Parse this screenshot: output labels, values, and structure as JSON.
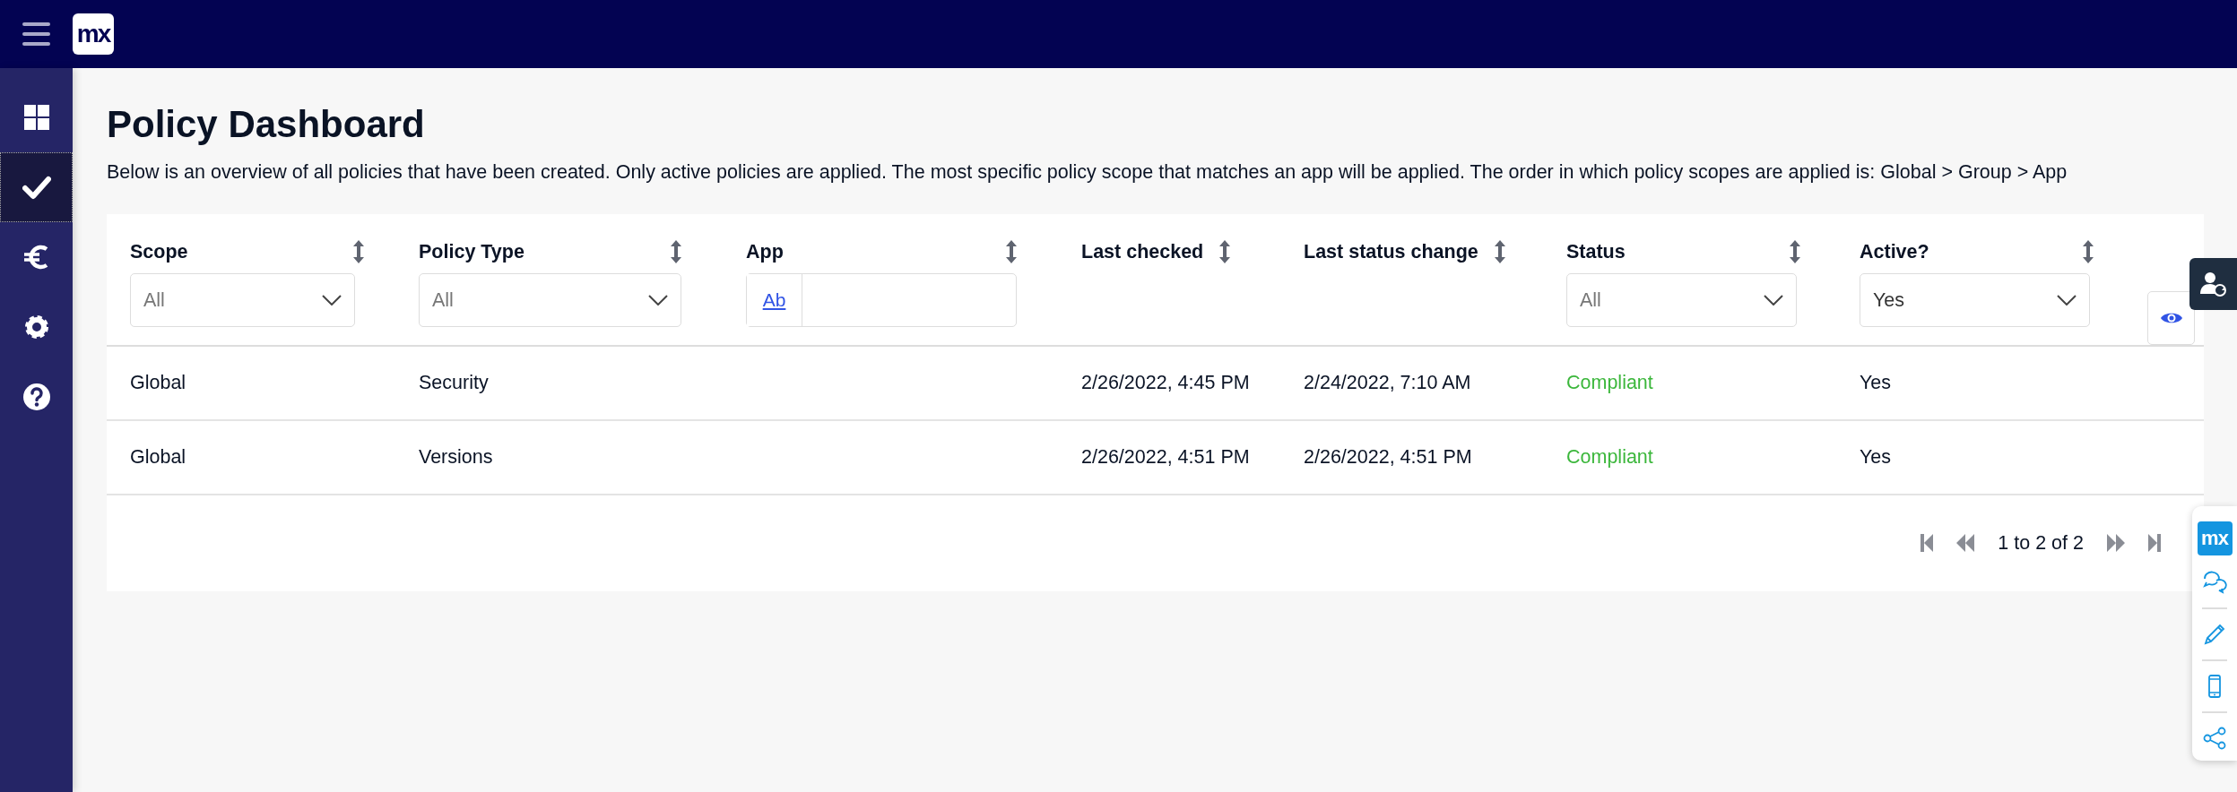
{
  "topbar": {
    "logo": "mx"
  },
  "sidebar": {
    "items": [
      {
        "kind": "grid",
        "selected": false
      },
      {
        "kind": "check",
        "selected": true
      },
      {
        "kind": "euro",
        "selected": false
      },
      {
        "kind": "gear",
        "selected": false
      },
      {
        "kind": "help",
        "selected": false
      }
    ]
  },
  "page": {
    "title": "Policy Dashboard",
    "description": "Below is an overview of all policies that have been created. Only active policies are applied. The most specific policy scope that matches an app will be applied. The order in which policy scopes are applied is: Global > Group > App"
  },
  "table": {
    "columns": [
      {
        "label": "Scope",
        "kind": "text",
        "filter": {
          "kind": "select",
          "placeholder": "All"
        }
      },
      {
        "label": "Policy Type",
        "kind": "text",
        "filter": {
          "kind": "select",
          "placeholder": "All"
        }
      },
      {
        "label": "App",
        "kind": "text",
        "filter": {
          "kind": "search",
          "mode_label": "Ab"
        }
      },
      {
        "label": "Last checked",
        "kind": "text"
      },
      {
        "label": "Last status change",
        "kind": "text"
      },
      {
        "label": "Status",
        "kind": "status",
        "filter": {
          "kind": "select",
          "placeholder": "All"
        }
      },
      {
        "label": "Active?",
        "kind": "text",
        "filter": {
          "kind": "select",
          "value": "Yes"
        }
      }
    ],
    "rows": [
      {
        "cells": [
          "Global",
          "Security",
          "",
          "2/26/2022, 4:45 PM",
          "2/24/2022, 7:10 AM",
          "Compliant",
          "Yes"
        ]
      },
      {
        "cells": [
          "Global",
          "Versions",
          "",
          "2/26/2022, 4:51 PM",
          "2/26/2022, 4:51 PM",
          "Compliant",
          "Yes"
        ]
      }
    ],
    "pagination": {
      "summary": "1 to 2 of 2"
    }
  },
  "side_toolbar": {
    "logo": "mx"
  }
}
